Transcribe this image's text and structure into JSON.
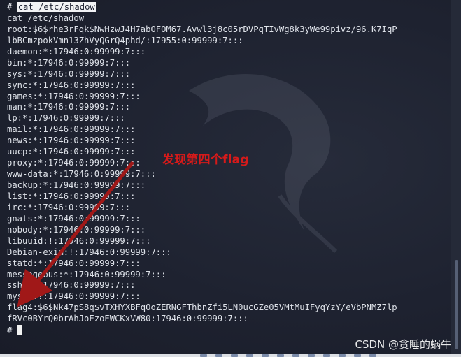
{
  "terminal": {
    "lines": [
      {
        "prompt": "# ",
        "text": "cat /etc/shadow",
        "highlight": true
      },
      {
        "prompt": "",
        "text": "cat /etc/shadow",
        "highlight": false
      },
      {
        "prompt": "",
        "text": "root:$6$rhe3rFqk$NwHzwJ4H7abOFOM67.Avwl3j8c05rDVPqTIvWg8k3yWe99pivz/96.K7IqP",
        "highlight": false
      },
      {
        "prompt": "",
        "text": "lbBCmzpokVmn13ZhVyQGrQ4phd/:17955:0:99999:7:::",
        "highlight": false
      },
      {
        "prompt": "",
        "text": "daemon:*:17946:0:99999:7:::",
        "highlight": false
      },
      {
        "prompt": "",
        "text": "bin:*:17946:0:99999:7:::",
        "highlight": false
      },
      {
        "prompt": "",
        "text": "sys:*:17946:0:99999:7:::",
        "highlight": false
      },
      {
        "prompt": "",
        "text": "sync:*:17946:0:99999:7:::",
        "highlight": false
      },
      {
        "prompt": "",
        "text": "games:*:17946:0:99999:7:::",
        "highlight": false
      },
      {
        "prompt": "",
        "text": "man:*:17946:0:99999:7:::",
        "highlight": false
      },
      {
        "prompt": "",
        "text": "lp:*:17946:0:99999:7:::",
        "highlight": false
      },
      {
        "prompt": "",
        "text": "mail:*:17946:0:99999:7:::",
        "highlight": false
      },
      {
        "prompt": "",
        "text": "news:*:17946:0:99999:7:::",
        "highlight": false
      },
      {
        "prompt": "",
        "text": "uucp:*:17946:0:99999:7:::",
        "highlight": false
      },
      {
        "prompt": "",
        "text": "proxy:*:17946:0:99999:7:::",
        "highlight": false
      },
      {
        "prompt": "",
        "text": "www-data:*:17946:0:99999:7:::",
        "highlight": false
      },
      {
        "prompt": "",
        "text": "backup:*:17946:0:99999:7:::",
        "highlight": false
      },
      {
        "prompt": "",
        "text": "list:*:17946:0:99999:7:::",
        "highlight": false
      },
      {
        "prompt": "",
        "text": "irc:*:17946:0:99999:7:::",
        "highlight": false
      },
      {
        "prompt": "",
        "text": "gnats:*:17946:0:99999:7:::",
        "highlight": false
      },
      {
        "prompt": "",
        "text": "nobody:*:17946:0:99999:7:::",
        "highlight": false
      },
      {
        "prompt": "",
        "text": "libuuid:!:17946:0:99999:7:::",
        "highlight": false
      },
      {
        "prompt": "",
        "text": "Debian-exim:!:17946:0:99999:7:::",
        "highlight": false
      },
      {
        "prompt": "",
        "text": "statd:*:17946:0:99999:7:::",
        "highlight": false
      },
      {
        "prompt": "",
        "text": "messagebus:*:17946:0:99999:7:::",
        "highlight": false
      },
      {
        "prompt": "",
        "text": "sshd:*:17946:0:99999:7:::",
        "highlight": false
      },
      {
        "prompt": "",
        "text": "mysql:!:17946:0:99999:7:::",
        "highlight": false
      },
      {
        "prompt": "",
        "text": "flag4:$6$Nk47pS8q$vTXHYXBFqOoZERNGFThbnZfi5LN0ucGZe05VMtMuIFyqYzY/eVbPNMZ7lp",
        "highlight": false
      },
      {
        "prompt": "",
        "text": "fRVc0BYrQ0brAhJoEzoEWCKxVW80:17946:0:99999:7:::",
        "highlight": false
      }
    ],
    "final_prompt": "# "
  },
  "annotation": {
    "text": "发现第四个flag",
    "color": "#d61a1a"
  },
  "watermark": {
    "text": "CSDN @贪睡的蜗牛"
  },
  "colors": {
    "background": "#1e2230",
    "foreground": "#dfe3ea",
    "annotation": "#d61a1a"
  },
  "icons": [
    "kali-dragon-logo-icon",
    "arrow-icon",
    "cursor-icon",
    "scrollbar-icon"
  ]
}
